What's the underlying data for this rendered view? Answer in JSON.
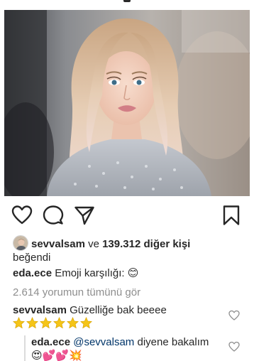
{
  "post": {
    "photo_alt": "Profile photo of a woman with long blonde hair"
  },
  "actions": {
    "like_icon": "heart-icon",
    "comment_icon": "comment-icon",
    "share_icon": "paper-plane-icon",
    "save_icon": "bookmark-icon"
  },
  "likes": {
    "user": "sevvalsam",
    "connector": " ve ",
    "others": "139.312 diğer kişi",
    "suffix": "beğendi"
  },
  "caption": {
    "username": "eda.ece",
    "text": " Emoji karşılığı: ",
    "emoji": "😊"
  },
  "comments_link": "2.614 yorumun tümünü gör",
  "comments": [
    {
      "username": "sevvalsam",
      "text": " Güzelliğe bak beeee",
      "stars": 6
    },
    {
      "username": "eda.ece",
      "mention": "@sevvalsam",
      "text": " diyene bakalım",
      "emojis": "😍💕💕💥"
    }
  ],
  "colors": {
    "text": "#262626",
    "muted": "#8e8e8e",
    "mention": "#003569",
    "star": "#f5c518"
  }
}
